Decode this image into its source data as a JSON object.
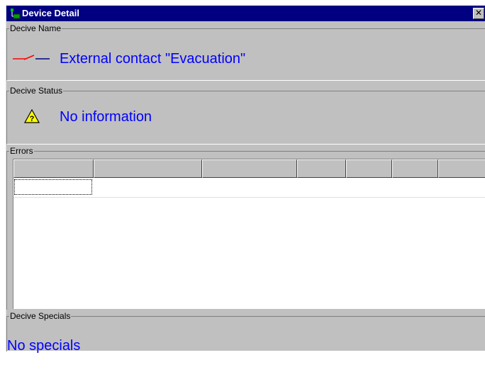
{
  "window": {
    "title": "Device Detail",
    "close_symbol": "✕",
    "icon": "device-tree-icon"
  },
  "name_group": {
    "legend": "Decive Name",
    "icon": "switch-contact-icon",
    "value": "External contact \"Evacuation\""
  },
  "status_group": {
    "legend": "Decive Status",
    "icon": "warning-question-icon",
    "value": "No information"
  },
  "errors_group": {
    "legend": "Errors",
    "columns": [
      "",
      "",
      "",
      "",
      "",
      "",
      ""
    ]
  },
  "specials_group": {
    "legend": "Decive Specials",
    "value": "No specials"
  },
  "colors": {
    "title_bar": "#000080",
    "value_text": "#0000ff",
    "face": "#c0c0c0"
  }
}
